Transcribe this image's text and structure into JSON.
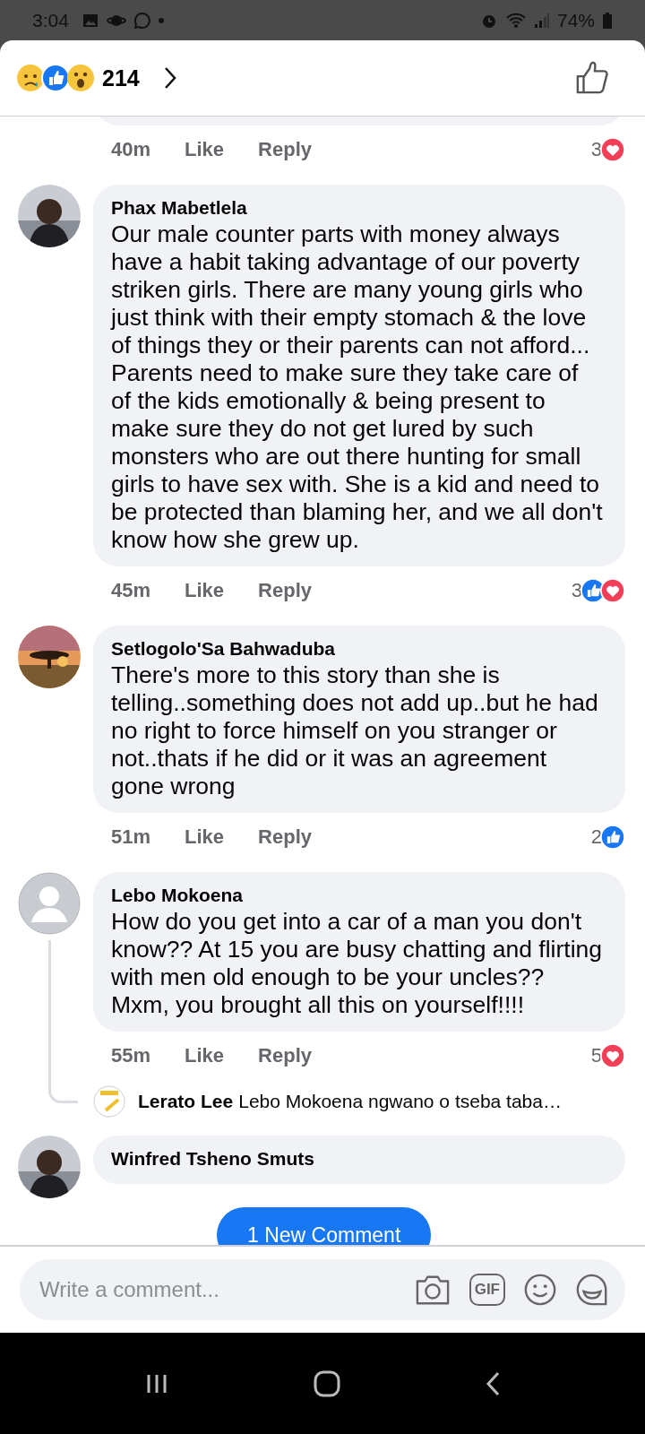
{
  "status_bar": {
    "time": "3:04",
    "battery": "74%"
  },
  "header": {
    "reactions": [
      {
        "kind": "sad"
      },
      {
        "kind": "like"
      },
      {
        "kind": "wow"
      }
    ],
    "reaction_count": "214"
  },
  "previous_comment": {
    "time": "40m",
    "like": "Like",
    "reply": "Reply",
    "reaction_count": "3",
    "reactions": [
      {
        "kind": "love"
      }
    ]
  },
  "comments": [
    {
      "avatar": {
        "kind": "picture"
      },
      "name": "Phax Mabetlela",
      "text": "Our male counter parts with money always have a habit taking advantage of our poverty striken girls. There are many young girls who just think with their empty stomach & the love of things they or their parents can not afford... Parents need to make sure they take care of of the kids emotionally & being present to make sure they do not get lured by such monsters who are out there hunting for small girls to have sex with. She is a kid and need to be protected than blaming her, and we all don't know how she grew up.",
      "time": "45m",
      "like": "Like",
      "reply": "Reply",
      "reaction_count": "3",
      "reactions": [
        {
          "kind": "like"
        },
        {
          "kind": "love"
        }
      ]
    },
    {
      "avatar": {
        "kind": "picture"
      },
      "name": "Setlogolo'Sa Bahwaduba",
      "text": "There's more to this story than she is telling..something does not add up..but he had no right to force himself on you stranger or not..thats if he did or it was an agreement gone wrong",
      "time": "51m",
      "like": "Like",
      "reply": "Reply",
      "reaction_count": "2",
      "reactions": [
        {
          "kind": "like"
        }
      ]
    },
    {
      "avatar": {
        "kind": "default"
      },
      "name": "Lebo Mokoena",
      "text": "How do you get into a car of a man you don't know?? At 15 you are busy chatting and flirting with men old enough to be your uncles?? Mxm, you brought all this on yourself!!!!",
      "time": "55m",
      "like": "Like",
      "reply": "Reply",
      "reaction_count": "5",
      "reactions": [
        {
          "kind": "love"
        }
      ],
      "replies": [
        {
          "name": "Lerato Lee",
          "text": "Lebo Mokoena ngwano o tseba taba…"
        }
      ]
    },
    {
      "avatar": {
        "kind": "picture"
      },
      "name": "Winfred Tsheno Smuts"
    }
  ],
  "new_comment_button": "1 New Comment",
  "composer": {
    "placeholder": "Write a comment...",
    "gif_label": "GIF"
  }
}
